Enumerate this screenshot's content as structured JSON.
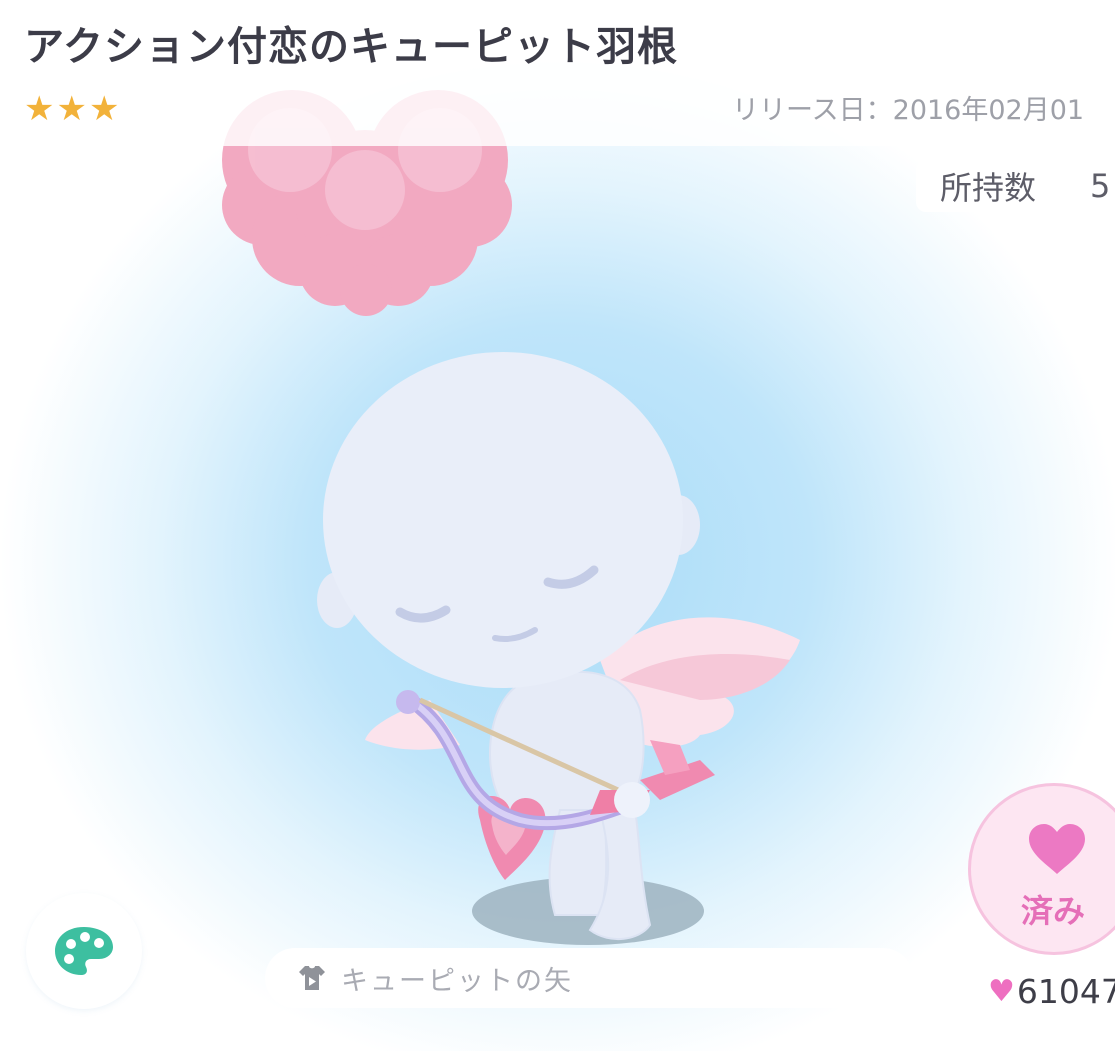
{
  "item": {
    "title": "アクション付恋のキューピット羽根",
    "rarity_stars": 3,
    "release_text": "リリース日：2016年02月01",
    "owned_label": "所持数",
    "owned_value": "5"
  },
  "bottom": {
    "sub_item_name": "キューピットの矢",
    "like_label": "済み",
    "like_count": "61047"
  },
  "icons": {
    "stars": "star-icon",
    "palette": "palette-icon",
    "shirt": "shirt-icon",
    "heart": "heart-icon"
  },
  "colors": {
    "accent_pink": "#e56fb8",
    "star_gold": "#f2b23a",
    "palette_teal": "#3dbfa0",
    "background_blue": "#a9dcf8"
  }
}
